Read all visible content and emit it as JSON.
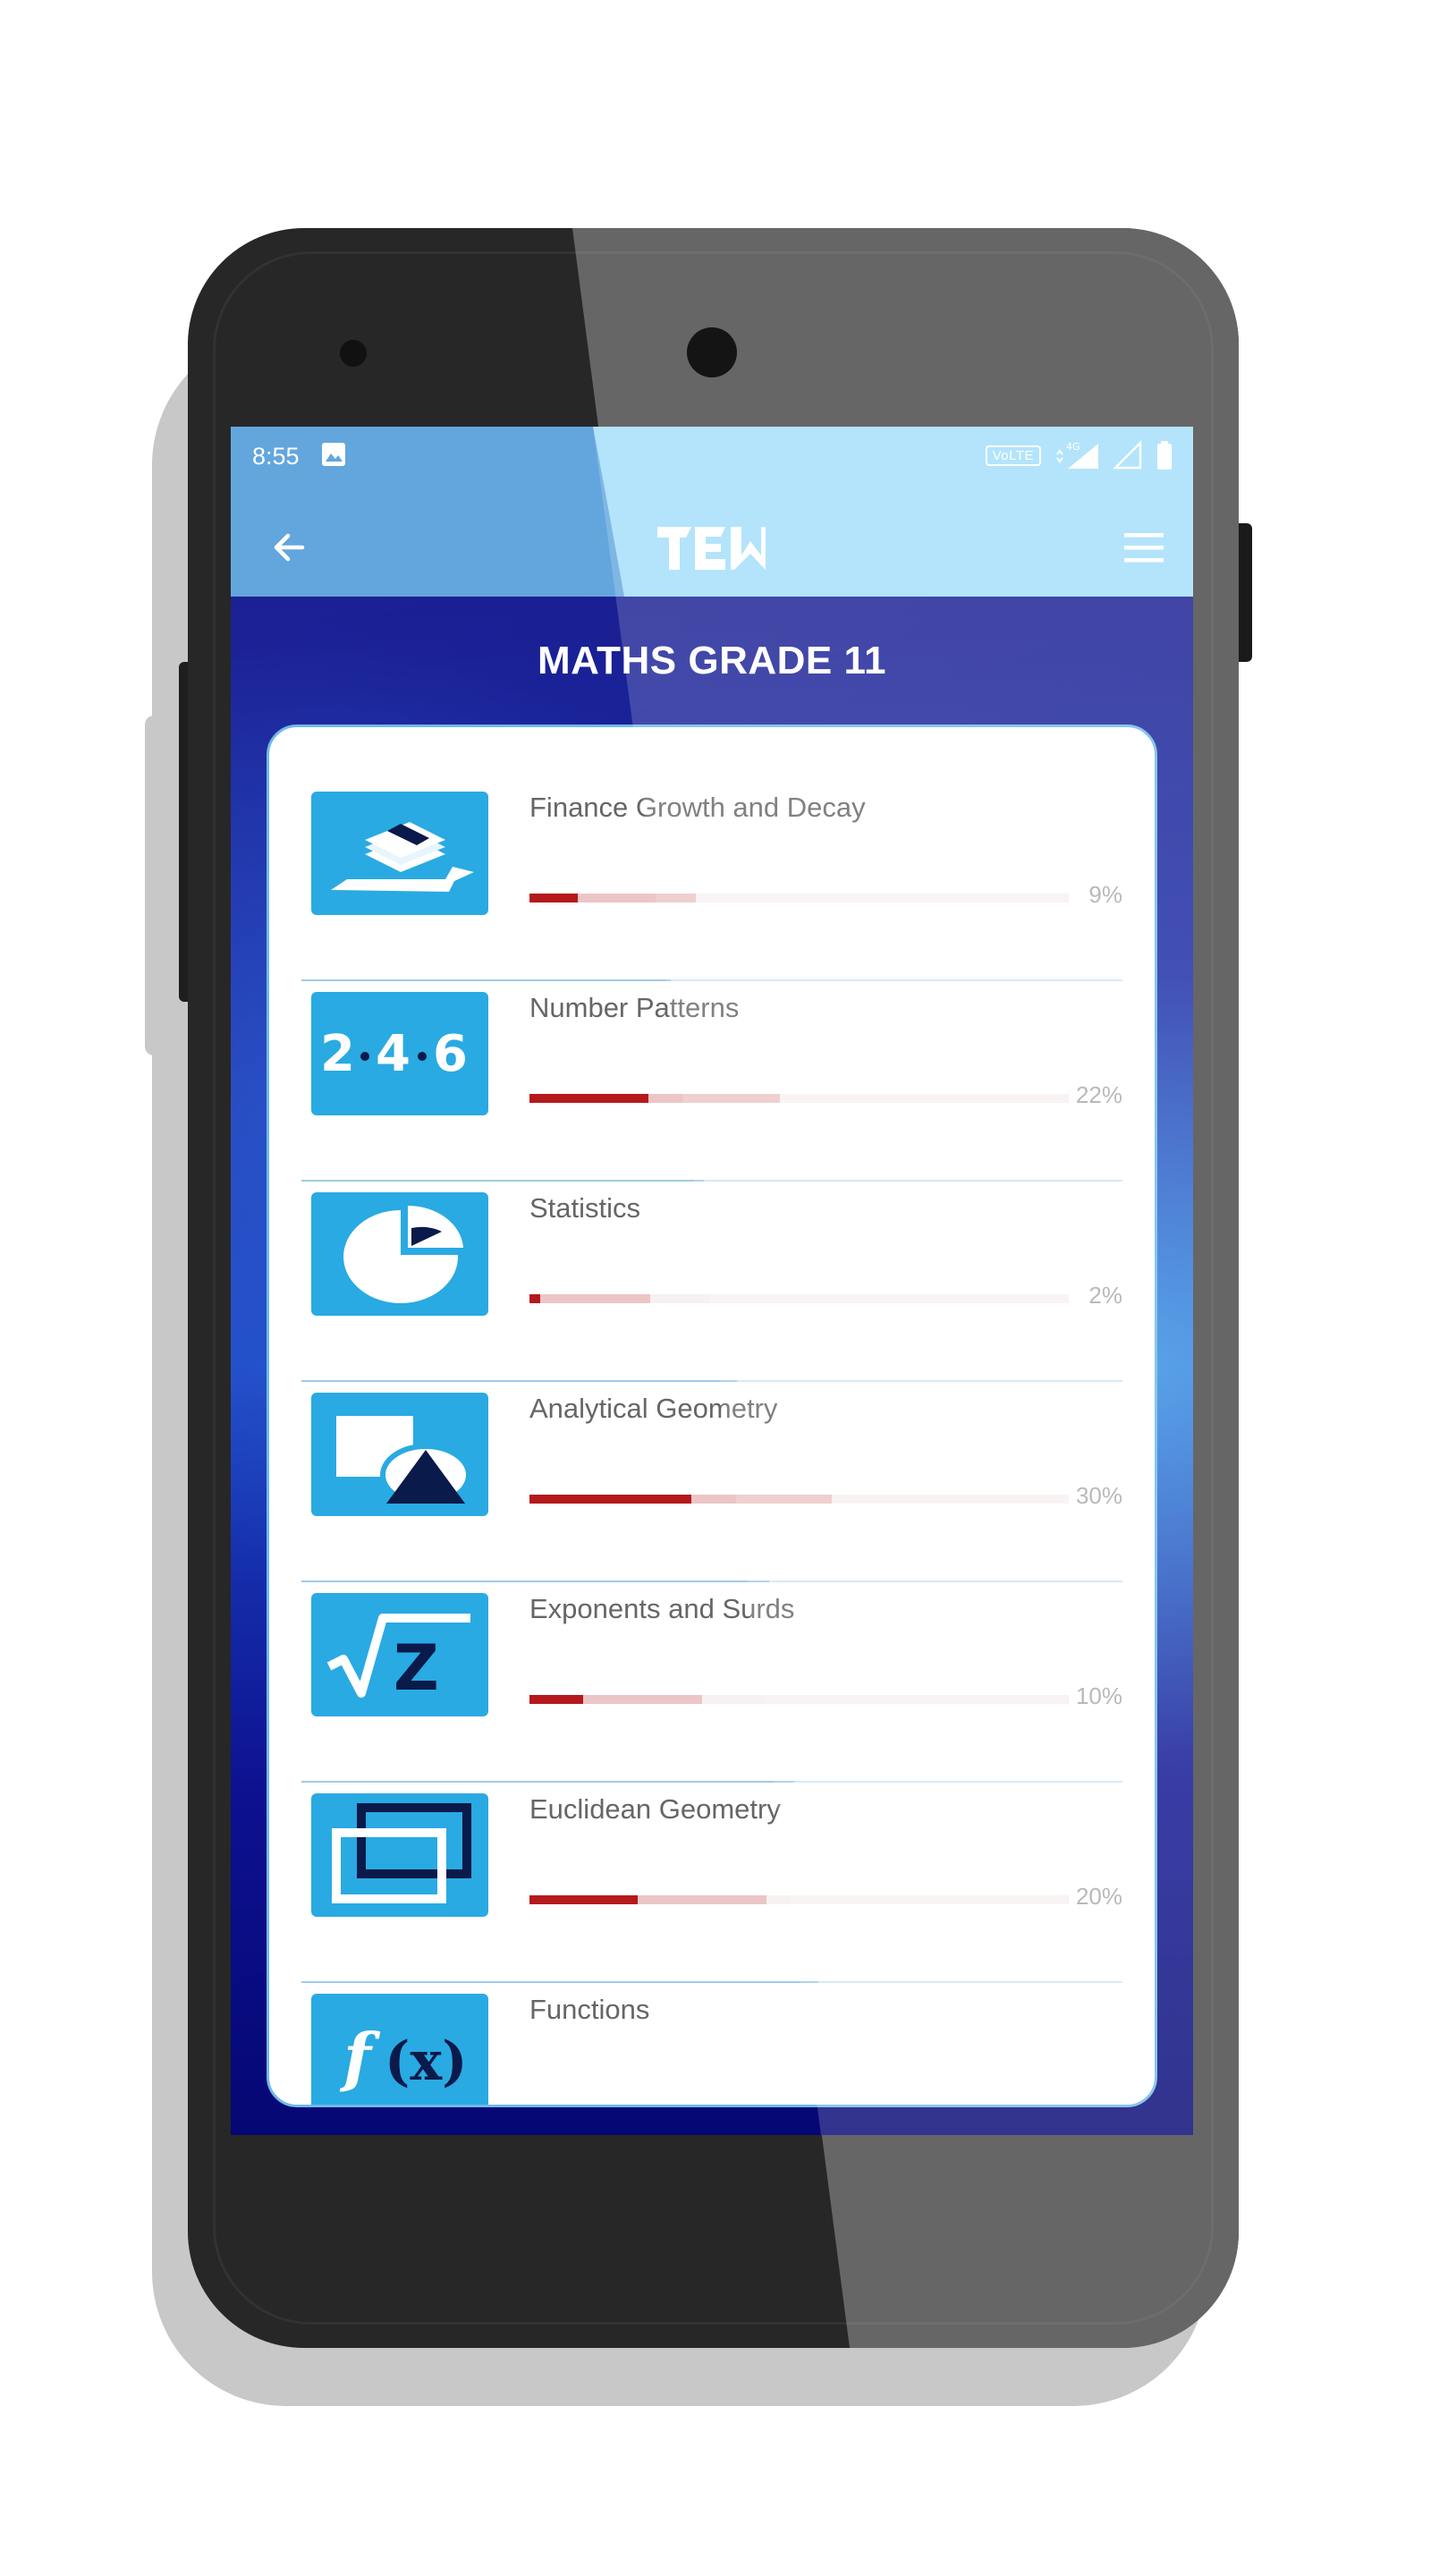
{
  "status_bar": {
    "time": "8:55",
    "volte": "VoLTE",
    "network": "4G"
  },
  "app_bar": {
    "back_icon": "arrow-left-icon",
    "logo_text": "TEN",
    "menu_icon": "hamburger-menu-icon"
  },
  "page": {
    "title": "MATHS GRADE 11"
  },
  "topics": [
    {
      "title": "Finance Growth and Decay",
      "percent_label": "9%",
      "progress": 0.09,
      "icon": "money-growth-icon"
    },
    {
      "title": "Number Patterns",
      "percent_label": "22%",
      "progress": 0.22,
      "icon": "number-pattern-icon"
    },
    {
      "title": "Statistics",
      "percent_label": "2%",
      "progress": 0.02,
      "icon": "pie-chart-icon"
    },
    {
      "title": "Analytical Geometry",
      "percent_label": "30%",
      "progress": 0.3,
      "icon": "shapes-icon"
    },
    {
      "title": "Exponents and Surds",
      "percent_label": "10%",
      "progress": 0.1,
      "icon": "square-root-icon"
    },
    {
      "title": "Euclidean Geometry",
      "percent_label": "20%",
      "progress": 0.2,
      "icon": "rectangles-icon"
    },
    {
      "title": "Functions",
      "percent_label": "",
      "progress": null,
      "icon": "function-icon"
    }
  ],
  "colors": {
    "status_bar": "#a3dffb",
    "accent_blue": "#29aae2",
    "progress_fill": "#b5191c",
    "card_border": "#6fb9ea"
  }
}
